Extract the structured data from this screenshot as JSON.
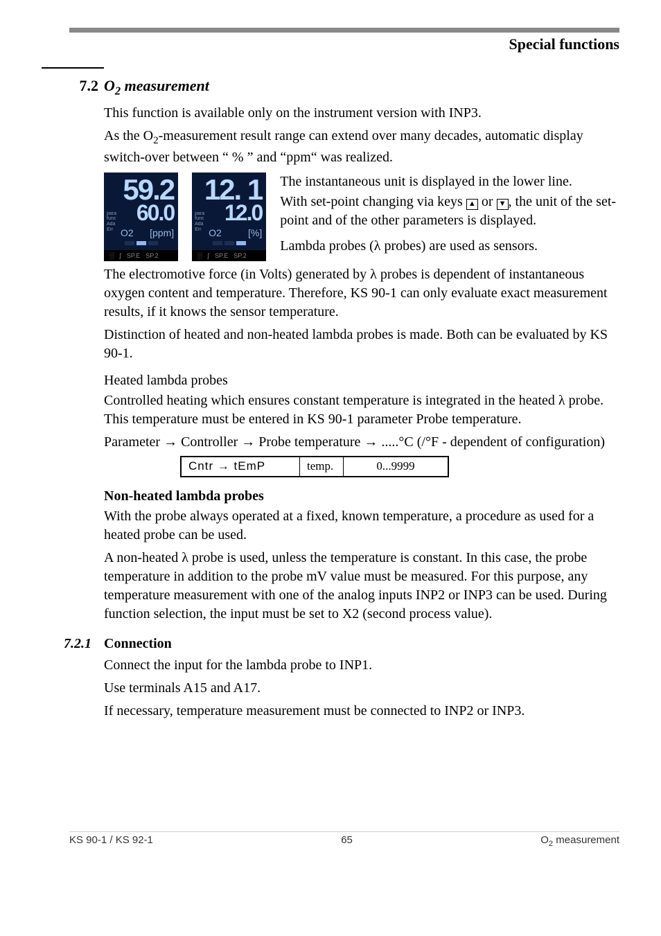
{
  "header": {
    "title": "Special functions"
  },
  "section": {
    "number": "7.2",
    "title_pre": "O",
    "title_sub": "2",
    "title_post": " measurement"
  },
  "intro": {
    "p1": "This function is available only on the instrument version with INP3.",
    "p2_pre": "As the O",
    "p2_sub": "2",
    "p2_post": "-measurement result range can extend over many decades, automatic display switch-over between “ % ” and “ppm“ was realized."
  },
  "lcd1": {
    "big": "59.2",
    "med": "60.0",
    "unit_left": "O2",
    "unit_right": "[ppm]",
    "side": [
      "para",
      "func",
      "Ada",
      "Err"
    ],
    "footer": [
      "░",
      "∫",
      "SP.E",
      "SP.2"
    ]
  },
  "lcd2": {
    "big": "12. 1",
    "med": "12.0",
    "unit_left": "O2",
    "unit_right": "[%]",
    "side": [
      "para",
      "func",
      "Ada",
      "Err"
    ],
    "footer": [
      "░",
      "∫",
      "SP.E",
      "SP.2"
    ]
  },
  "fig_text": {
    "t1": "The instantaneous unit is displayed in the lower line.",
    "t2a": "With set-point changing via keys ",
    "t2b": " or ",
    "t2c": ", the unit of the set-point and of the other parameters is displayed.",
    "t3": "Lambda probes (λ probes) are used as sensors."
  },
  "keys": {
    "up": "▲",
    "down": "▼"
  },
  "body2": {
    "p1": "The electromotive force (in Volts) generated by λ probes is dependent of instantaneous oxygen content and temperature. Therefore, KS 90-1 can only evaluate exact measurement results, if it knows the sensor temperature.",
    "p2": "Distinction of heated and non-heated lambda probes is made. Both can be evaluated by KS 90-1."
  },
  "heated": {
    "title": "Heated lambda probes",
    "p1": "Controlled heating which ensures constant temperature is integrated in the heated λ probe. This temperature must be entered in KS 90-1 parameter Probe temperature.",
    "p2": "Parameter → Controller → Probe temperature → .....°C (/°F - dependent of configuration)"
  },
  "param_table": {
    "cell1": "Cntr → tEmP",
    "cell2": "temp.",
    "cell3": "0...9999"
  },
  "nonheated": {
    "title": "Non-heated lambda probes",
    "p1": "With the probe always operated at a fixed, known temperature, a procedure as used for a heated probe can be used.",
    "p2": "A non-heated λ probe is used, unless the temperature is constant. In this case, the probe temperature in addition to the probe mV value must be measured. For this purpose, any temperature measurement with one of the analog inputs INP2 or INP3 can be used. During function selection, the input must be set to X2 (second process value)."
  },
  "subsection": {
    "number": "7.2.1",
    "title": "Connection",
    "p1": "Connect the input for the lambda probe to INP1.",
    "p2": "Use terminals A15 and A17.",
    "p3": "If necessary, temperature measurement must be connected to INP2 or INP3."
  },
  "footer": {
    "left": "KS 90-1 / KS 92-1",
    "center": "65",
    "right_pre": "O",
    "right_sub": "2",
    "right_post": " measurement"
  }
}
